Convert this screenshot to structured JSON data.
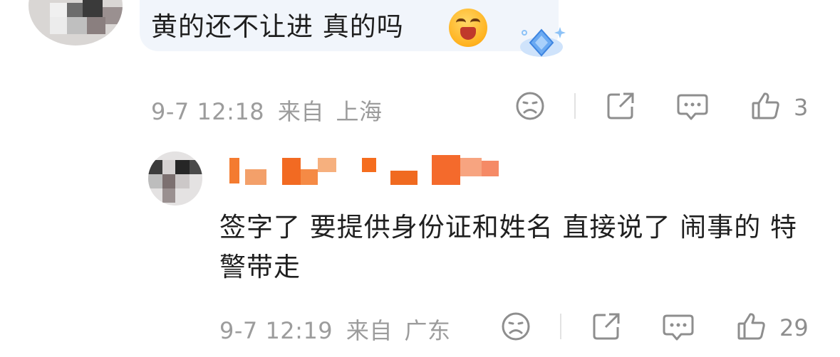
{
  "comments": [
    {
      "text": "黄的还不让进 真的吗",
      "emoji": "scream-laugh-emoji",
      "badge": "diamond-badge-icon",
      "time": "9-7 12:18",
      "location_label": "来自",
      "location": "上海",
      "likes": "3"
    },
    {
      "text": "签字了 要提供身份证和姓名 直接说了 闹事的 特警带走",
      "time": "9-7 12:19",
      "location_label": "来自",
      "location": "广东",
      "likes": "29"
    }
  ],
  "actions": [
    "dislike-icon",
    "share-icon",
    "reply-icon",
    "like-icon"
  ],
  "colors": {
    "meta": "#9c9c9c",
    "bubble": "#f1f5fb",
    "username_blur": "#f5732a"
  }
}
